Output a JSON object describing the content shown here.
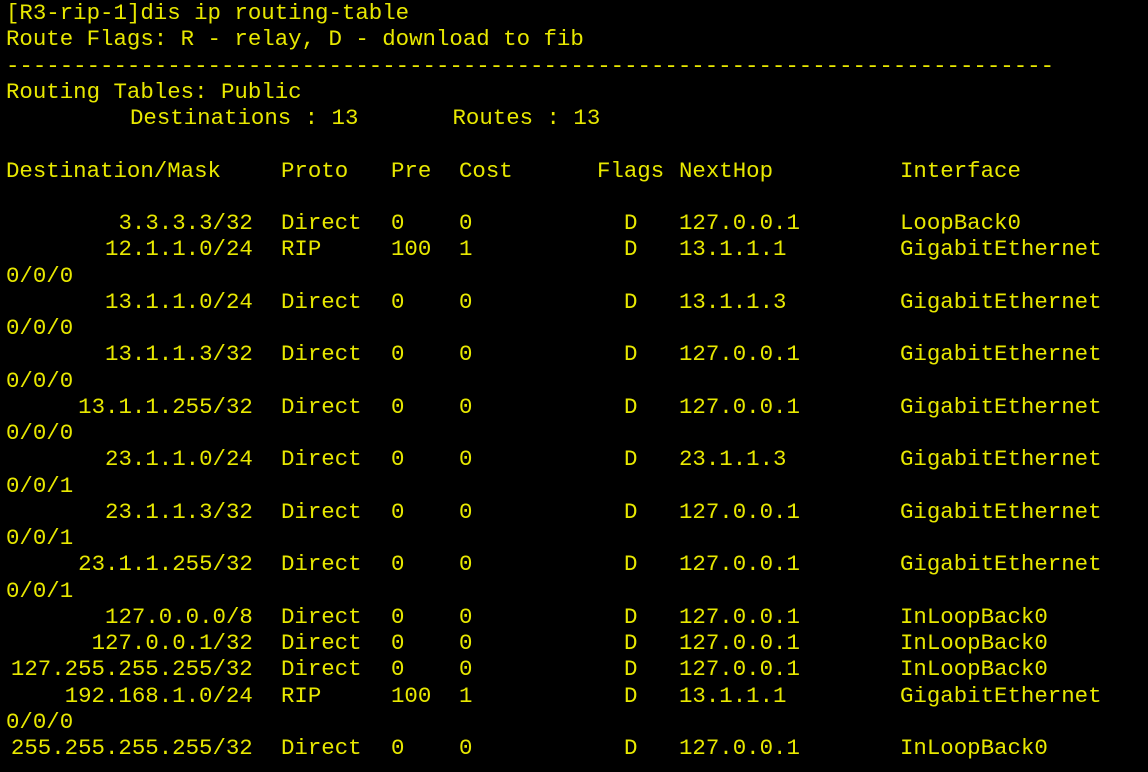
{
  "terminal": {
    "fg_color": "#e8e800",
    "bg_color": "#000000",
    "command_line": "[R3-rip-1]dis ip routing-table",
    "flags_legend": "Route Flags: R - relay, D - download to fib",
    "separator": "------------------------------------------------------------------------------",
    "routing_tables_label": "Routing Tables: Public",
    "summary": "Destinations : 13       Routes : 13",
    "headers": {
      "destination": "Destination/Mask",
      "proto": "Proto",
      "pre": "Pre",
      "cost": "Cost",
      "flags": "Flags",
      "nexthop": "NextHop",
      "interface": "Interface"
    },
    "routes": [
      {
        "dest": "3.3.3.3/32",
        "proto": "Direct",
        "pre": "0",
        "cost": "0",
        "flags": "D",
        "nexthop": "127.0.0.1",
        "iface": "LoopBack0",
        "iface_cont": ""
      },
      {
        "dest": "12.1.1.0/24",
        "proto": "RIP",
        "pre": "100",
        "cost": "1",
        "flags": "D",
        "nexthop": "13.1.1.1",
        "iface": "GigabitEthernet",
        "iface_cont": "0/0/0"
      },
      {
        "dest": "13.1.1.0/24",
        "proto": "Direct",
        "pre": "0",
        "cost": "0",
        "flags": "D",
        "nexthop": "13.1.1.3",
        "iface": "GigabitEthernet",
        "iface_cont": "0/0/0"
      },
      {
        "dest": "13.1.1.3/32",
        "proto": "Direct",
        "pre": "0",
        "cost": "0",
        "flags": "D",
        "nexthop": "127.0.0.1",
        "iface": "GigabitEthernet",
        "iface_cont": "0/0/0"
      },
      {
        "dest": "13.1.1.255/32",
        "proto": "Direct",
        "pre": "0",
        "cost": "0",
        "flags": "D",
        "nexthop": "127.0.0.1",
        "iface": "GigabitEthernet",
        "iface_cont": "0/0/0"
      },
      {
        "dest": "23.1.1.0/24",
        "proto": "Direct",
        "pre": "0",
        "cost": "0",
        "flags": "D",
        "nexthop": "23.1.1.3",
        "iface": "GigabitEthernet",
        "iface_cont": "0/0/1"
      },
      {
        "dest": "23.1.1.3/32",
        "proto": "Direct",
        "pre": "0",
        "cost": "0",
        "flags": "D",
        "nexthop": "127.0.0.1",
        "iface": "GigabitEthernet",
        "iface_cont": "0/0/1"
      },
      {
        "dest": "23.1.1.255/32",
        "proto": "Direct",
        "pre": "0",
        "cost": "0",
        "flags": "D",
        "nexthop": "127.0.0.1",
        "iface": "GigabitEthernet",
        "iface_cont": "0/0/1"
      },
      {
        "dest": "127.0.0.0/8",
        "proto": "Direct",
        "pre": "0",
        "cost": "0",
        "flags": "D",
        "nexthop": "127.0.0.1",
        "iface": "InLoopBack0",
        "iface_cont": ""
      },
      {
        "dest": "127.0.0.1/32",
        "proto": "Direct",
        "pre": "0",
        "cost": "0",
        "flags": "D",
        "nexthop": "127.0.0.1",
        "iface": "InLoopBack0",
        "iface_cont": ""
      },
      {
        "dest": "127.255.255.255/32",
        "proto": "Direct",
        "pre": "0",
        "cost": "0",
        "flags": "D",
        "nexthop": "127.0.0.1",
        "iface": "InLoopBack0",
        "iface_cont": ""
      },
      {
        "dest": "192.168.1.0/24",
        "proto": "RIP",
        "pre": "100",
        "cost": "1",
        "flags": "D",
        "nexthop": "13.1.1.1",
        "iface": "GigabitEthernet",
        "iface_cont": "0/0/0"
      },
      {
        "dest": "255.255.255.255/32",
        "proto": "Direct",
        "pre": "0",
        "cost": "0",
        "flags": "D",
        "nexthop": "127.0.0.1",
        "iface": "InLoopBack0",
        "iface_cont": ""
      }
    ]
  }
}
